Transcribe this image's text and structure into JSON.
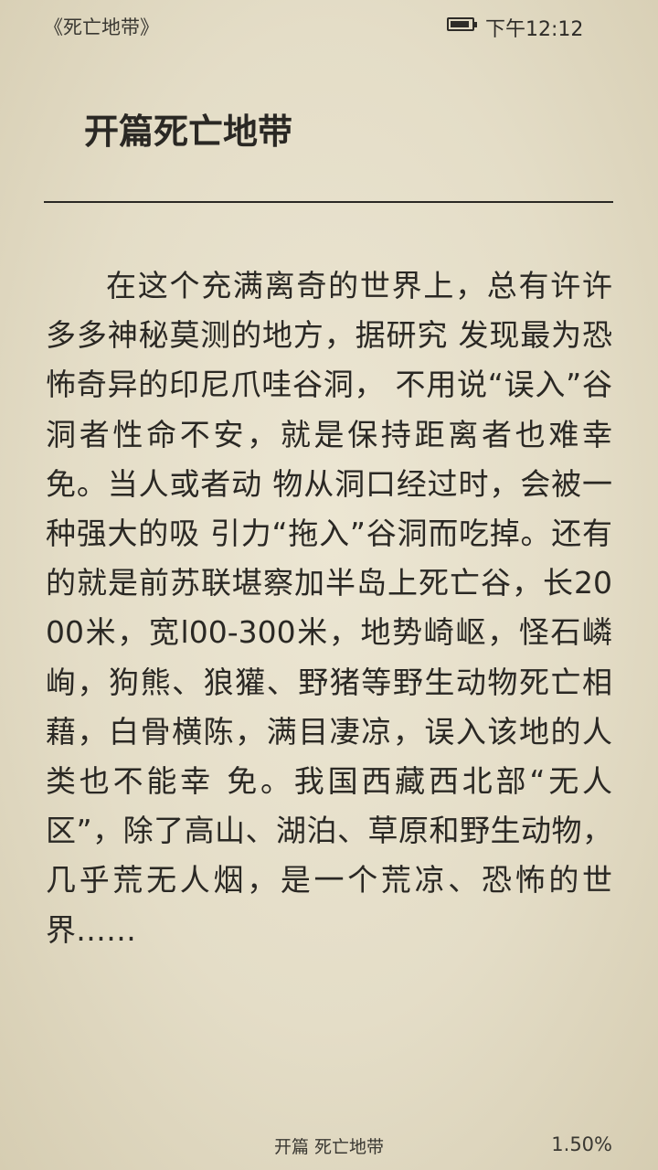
{
  "status_bar": {
    "book_title": "《死亡地带》",
    "battery_level": 0.9,
    "time": "下午12:12"
  },
  "chapter": {
    "title": "开篇死亡地带",
    "body": "在这个充满离奇的世界上，总有许许多多神秘莫测的地方，据研究 发现最为恐怖奇异的印尼爪哇谷洞， 不用说“误入”谷洞者性命不安，就是保持距离者也难幸免。当人或者动 物从洞口经过时，会被一种强大的吸 引力“拖入”谷洞而吃掉。还有的就是前苏联堪察加半岛上死亡谷，长2000米，宽l00-300米，地势崎岖，怪石嶙峋，狗熊、狼獾、野猪等野生动物死亡相藉，白骨横陈，满目凄凉，误入该地的人类也不能幸 免。我国西藏西北部“无人区”，除了高山、湖泊、草原和野生动物，几乎荒无人烟，是一个荒凉、恐怖的世界……"
  },
  "footer": {
    "chapter_label": "开篇 死亡地带",
    "progress": "1.50%"
  }
}
